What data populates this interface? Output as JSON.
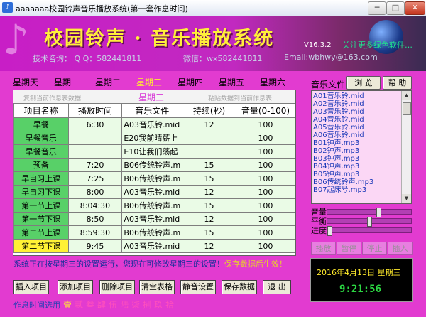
{
  "window": {
    "title": "aaaaaaa校园铃声音乐播放系统(第一套作息时间)",
    "minimize": "─",
    "maximize": "□",
    "close": "✕"
  },
  "banner": {
    "title": "校园铃声 · 音乐播放系统",
    "version": "V16.3.2",
    "follow_text": "关注更多绿色软件…",
    "contact": "技术咨询：   Q Q：582441811",
    "wechat": "微信：wx582441811",
    "email": "Email:wbhwy@163.com"
  },
  "days": [
    "星期天",
    "星期一",
    "星期二",
    "星期三",
    "星期四",
    "星期五",
    "星期六"
  ],
  "active_day": "星期三",
  "toolbar": {
    "music_files_label": "音乐文件",
    "browse": "浏 览",
    "help": "帮 助"
  },
  "schedule": {
    "copy_hint": "复制当前作息表数据",
    "day_title": "星期三",
    "paste_hint": "粘贴数据到当前作息表",
    "headers": [
      "项目名称",
      "播放时间",
      "音乐文件",
      "持续(秒)",
      "音量(0-100)"
    ],
    "rows": [
      {
        "name": "早餐",
        "time": "6:30",
        "file": "A03音乐铃.mid",
        "dur": "12",
        "vol": "100"
      },
      {
        "name": "早餐音乐",
        "time": "",
        "file": "E20我前晴薪上",
        "dur": "",
        "vol": "100"
      },
      {
        "name": "早餐音乐",
        "time": "",
        "file": "E10让我们荡起",
        "dur": "",
        "vol": "100"
      },
      {
        "name": "预备",
        "time": "7:20",
        "file": "B06传统铃声.m",
        "dur": "15",
        "vol": "100"
      },
      {
        "name": "早自习上课",
        "time": "7:25",
        "file": "B06传统铃声.m",
        "dur": "15",
        "vol": "100"
      },
      {
        "name": "早自习下课",
        "time": "8:00",
        "file": "A03音乐铃.mid",
        "dur": "12",
        "vol": "100"
      },
      {
        "name": "第一节上课",
        "time": "8:04:30",
        "file": "B06传统铃声.m",
        "dur": "15",
        "vol": "100"
      },
      {
        "name": "第一节下课",
        "time": "8:50",
        "file": "A03音乐铃.mid",
        "dur": "12",
        "vol": "100"
      },
      {
        "name": "第二节上课",
        "time": "8:59:30",
        "file": "B06传统铃声.m",
        "dur": "15",
        "vol": "100"
      },
      {
        "name": "第二节下课",
        "time": "9:45",
        "file": "A03音乐铃.mid",
        "dur": "12",
        "vol": "100"
      }
    ]
  },
  "files": [
    "A01音乐铃.mid",
    "A02音乐铃.mid",
    "A03音乐铃.mid",
    "A04音乐铃.mid",
    "A05音乐铃.mid",
    "A06音乐铃.mid",
    "B01钟声.mp3",
    "B02钟声.mp3",
    "B03钟声.mp3",
    "B04钟声.mp3",
    "B05钟声.mp3",
    "B06传统铃声.mp3",
    "B07起床号.mp3"
  ],
  "sliders": {
    "volume_label": "音量",
    "balance_label": "平衡",
    "progress_label": "进度",
    "volume_level": 0.62,
    "balance_level": 0.5,
    "progress_level": 0
  },
  "player": {
    "play": "播放",
    "pause": "暂停",
    "stop": "停止",
    "insert": "插入"
  },
  "status": {
    "text": "系统正在按星期三的设置运行，您现在可修改星期三的设置！",
    "warn": "保存数据后生效！"
  },
  "clock": {
    "date": "2016年4月13日  星期三",
    "time": "9:21:56"
  },
  "actions": {
    "insert": "插入项目",
    "add": "添加项目",
    "delete": "删除项目",
    "clear": "清空表格",
    "mute": "静音设置",
    "save": "保存数据",
    "exit": "退 出"
  },
  "schemes": {
    "label": "作息时间选用",
    "options": [
      "壹",
      "贰",
      "叁",
      "肆",
      "伍",
      "陆",
      "柒",
      "捌",
      "玖",
      "拾"
    ]
  },
  "colors": {
    "window_bg": "#e23bd0",
    "grid_name_cell": "#58d068",
    "selected_cell": "#fff235",
    "active_day": "#ffeb32",
    "clock_time": "#2bd642"
  }
}
